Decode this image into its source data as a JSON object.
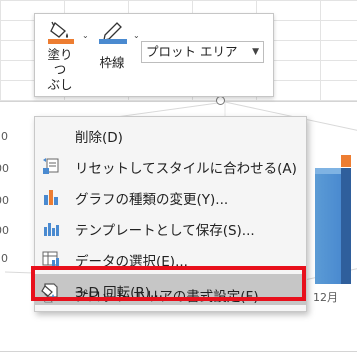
{
  "mini_toolbar": {
    "fill": {
      "line1": "塗りつ",
      "line2": "ぶし"
    },
    "outline": {
      "label": "枠線"
    },
    "element_select": {
      "value": "プロット エリア"
    }
  },
  "chart": {
    "y_ticks": [
      "0",
      "00",
      "00",
      "00",
      "0"
    ],
    "x_label": "12月"
  },
  "context_menu": {
    "items": [
      {
        "label": "削除(D)"
      },
      {
        "label": "リセットしてスタイルに合わせる(A)"
      },
      {
        "label": "グラフの種類の変更(Y)..."
      },
      {
        "label": "テンプレートとして保存(S)..."
      },
      {
        "label": "データの選択(E)..."
      },
      {
        "label": "3-D 回転(R)..."
      },
      {
        "label": "プロット エリアの書式設定(F)..."
      }
    ]
  },
  "colors": {
    "highlight": "#c6c6c6",
    "red_outline": "#e8101c",
    "bar_blue": "#5b9bd5",
    "fill_orange": "#ed7d31"
  }
}
